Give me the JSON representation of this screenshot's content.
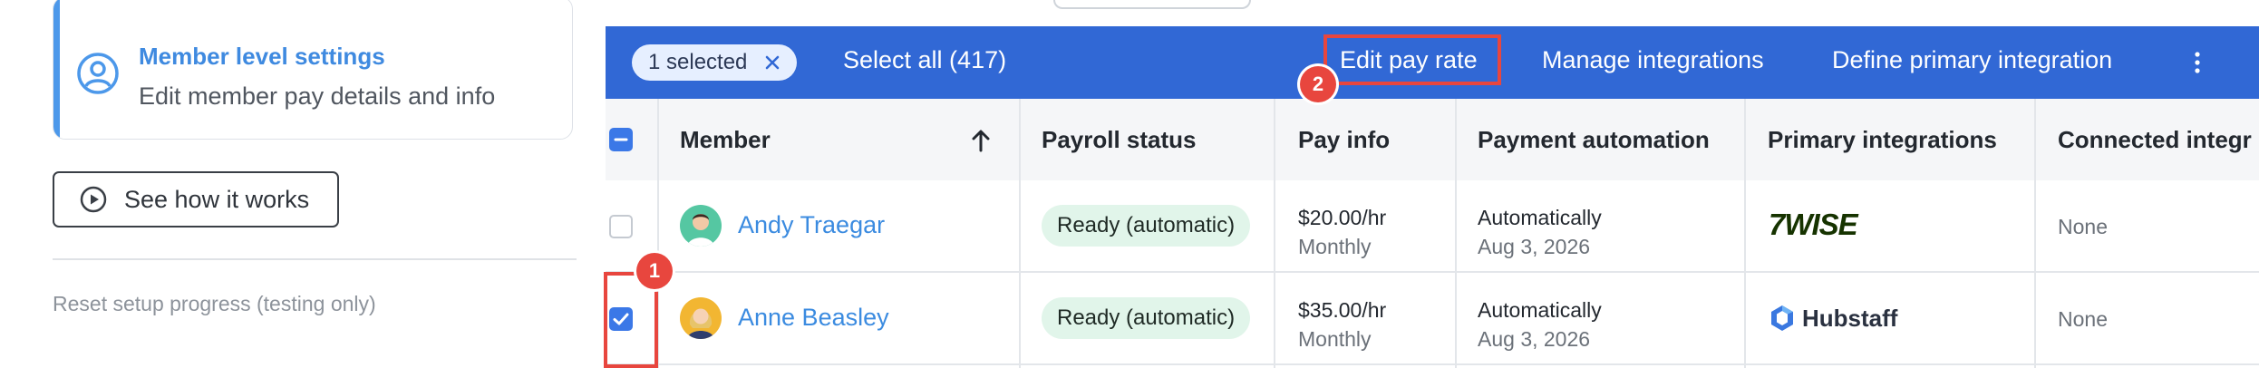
{
  "sidebar": {
    "settings_card": {
      "title": "Member level settings",
      "description": "Edit member pay details and info",
      "icon": "user-circle-icon"
    },
    "see_how_label": "See how it works",
    "see_how_icon": "play-circle-icon",
    "reset_label": "Reset setup progress (testing only)"
  },
  "bulk_bar": {
    "selected_label": "1 selected",
    "select_all_label": "Select all (417)",
    "actions": [
      "Edit pay rate",
      "Manage integrations",
      "Define primary integration"
    ]
  },
  "table": {
    "columns": [
      "Member",
      "Payroll status",
      "Pay info",
      "Payment automation",
      "Primary integrations",
      "Connected integr"
    ],
    "rows": [
      {
        "name": "Andy Traegar",
        "status": "Ready (automatic)",
        "pay_rate": "$20.00/hr",
        "pay_period": "Monthly",
        "automation": "Automatically",
        "automation_date": "Aug 3, 2026",
        "integration": "7WISE",
        "connected": "None",
        "checked": false
      },
      {
        "name": "Anne Beasley",
        "status": "Ready (automatic)",
        "pay_rate": "$35.00/hr",
        "pay_period": "Monthly",
        "automation": "Automatically",
        "automation_date": "Aug 3, 2026",
        "integration": "Hubstaff",
        "connected": "None",
        "checked": true
      }
    ]
  },
  "annotations": [
    "1",
    "2"
  ],
  "colors": {
    "bar_blue": "#3168d5",
    "link_blue": "#3b8be0",
    "status_green_bg": "#e1f5ea",
    "highlight_red": "#e8463e",
    "accent_blue": "#4c98ea"
  }
}
